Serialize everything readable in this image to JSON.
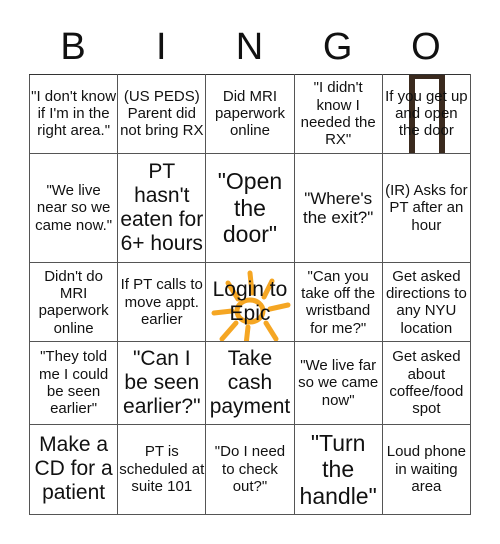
{
  "header": {
    "letters": [
      "B",
      "I",
      "N",
      "G",
      "O"
    ]
  },
  "colors": {
    "sun": "#F5A623",
    "door_frame": "#3a2a1e",
    "grid_line": "#555555"
  },
  "grid": {
    "rows": [
      [
        {
          "text": "\"I don't know if I'm in the right area.\""
        },
        {
          "text": "(US PEDS) Parent did not bring RX"
        },
        {
          "text": "Did MRI paperwork online"
        },
        {
          "text": "\"I didn't know I needed the RX\""
        },
        {
          "text": "If you get up and open the door",
          "image": "door-icon"
        }
      ],
      [
        {
          "text": "\"We live near so we came now.\""
        },
        {
          "text": "PT hasn't eaten for 6+ hours"
        },
        {
          "text": "\"Open the door\""
        },
        {
          "text": "\"Where's the exit?\""
        },
        {
          "text": "(IR) Asks for PT after an hour"
        }
      ],
      [
        {
          "text": "Didn't do MRI paperwork online"
        },
        {
          "text": "If PT calls to move appt. earlier"
        },
        {
          "text": "Login to Epic",
          "image": "sun-icon",
          "free_space": true
        },
        {
          "text": "\"Can you take off the wristband for me?\""
        },
        {
          "text": "Get asked directions to any NYU location"
        }
      ],
      [
        {
          "text": "\"They told me I could be seen earlier\""
        },
        {
          "text": "\"Can I be seen earlier?\""
        },
        {
          "text": "Take cash payment"
        },
        {
          "text": "\"We live far so we came now\""
        },
        {
          "text": "Get asked about coffee/food spot"
        }
      ],
      [
        {
          "text": "Make a CD for a patient"
        },
        {
          "text": "PT is scheduled at suite 101"
        },
        {
          "text": "\"Do I need to check out?\""
        },
        {
          "text": "\"Turn the handle\""
        },
        {
          "text": "Loud phone in waiting area"
        }
      ]
    ]
  }
}
